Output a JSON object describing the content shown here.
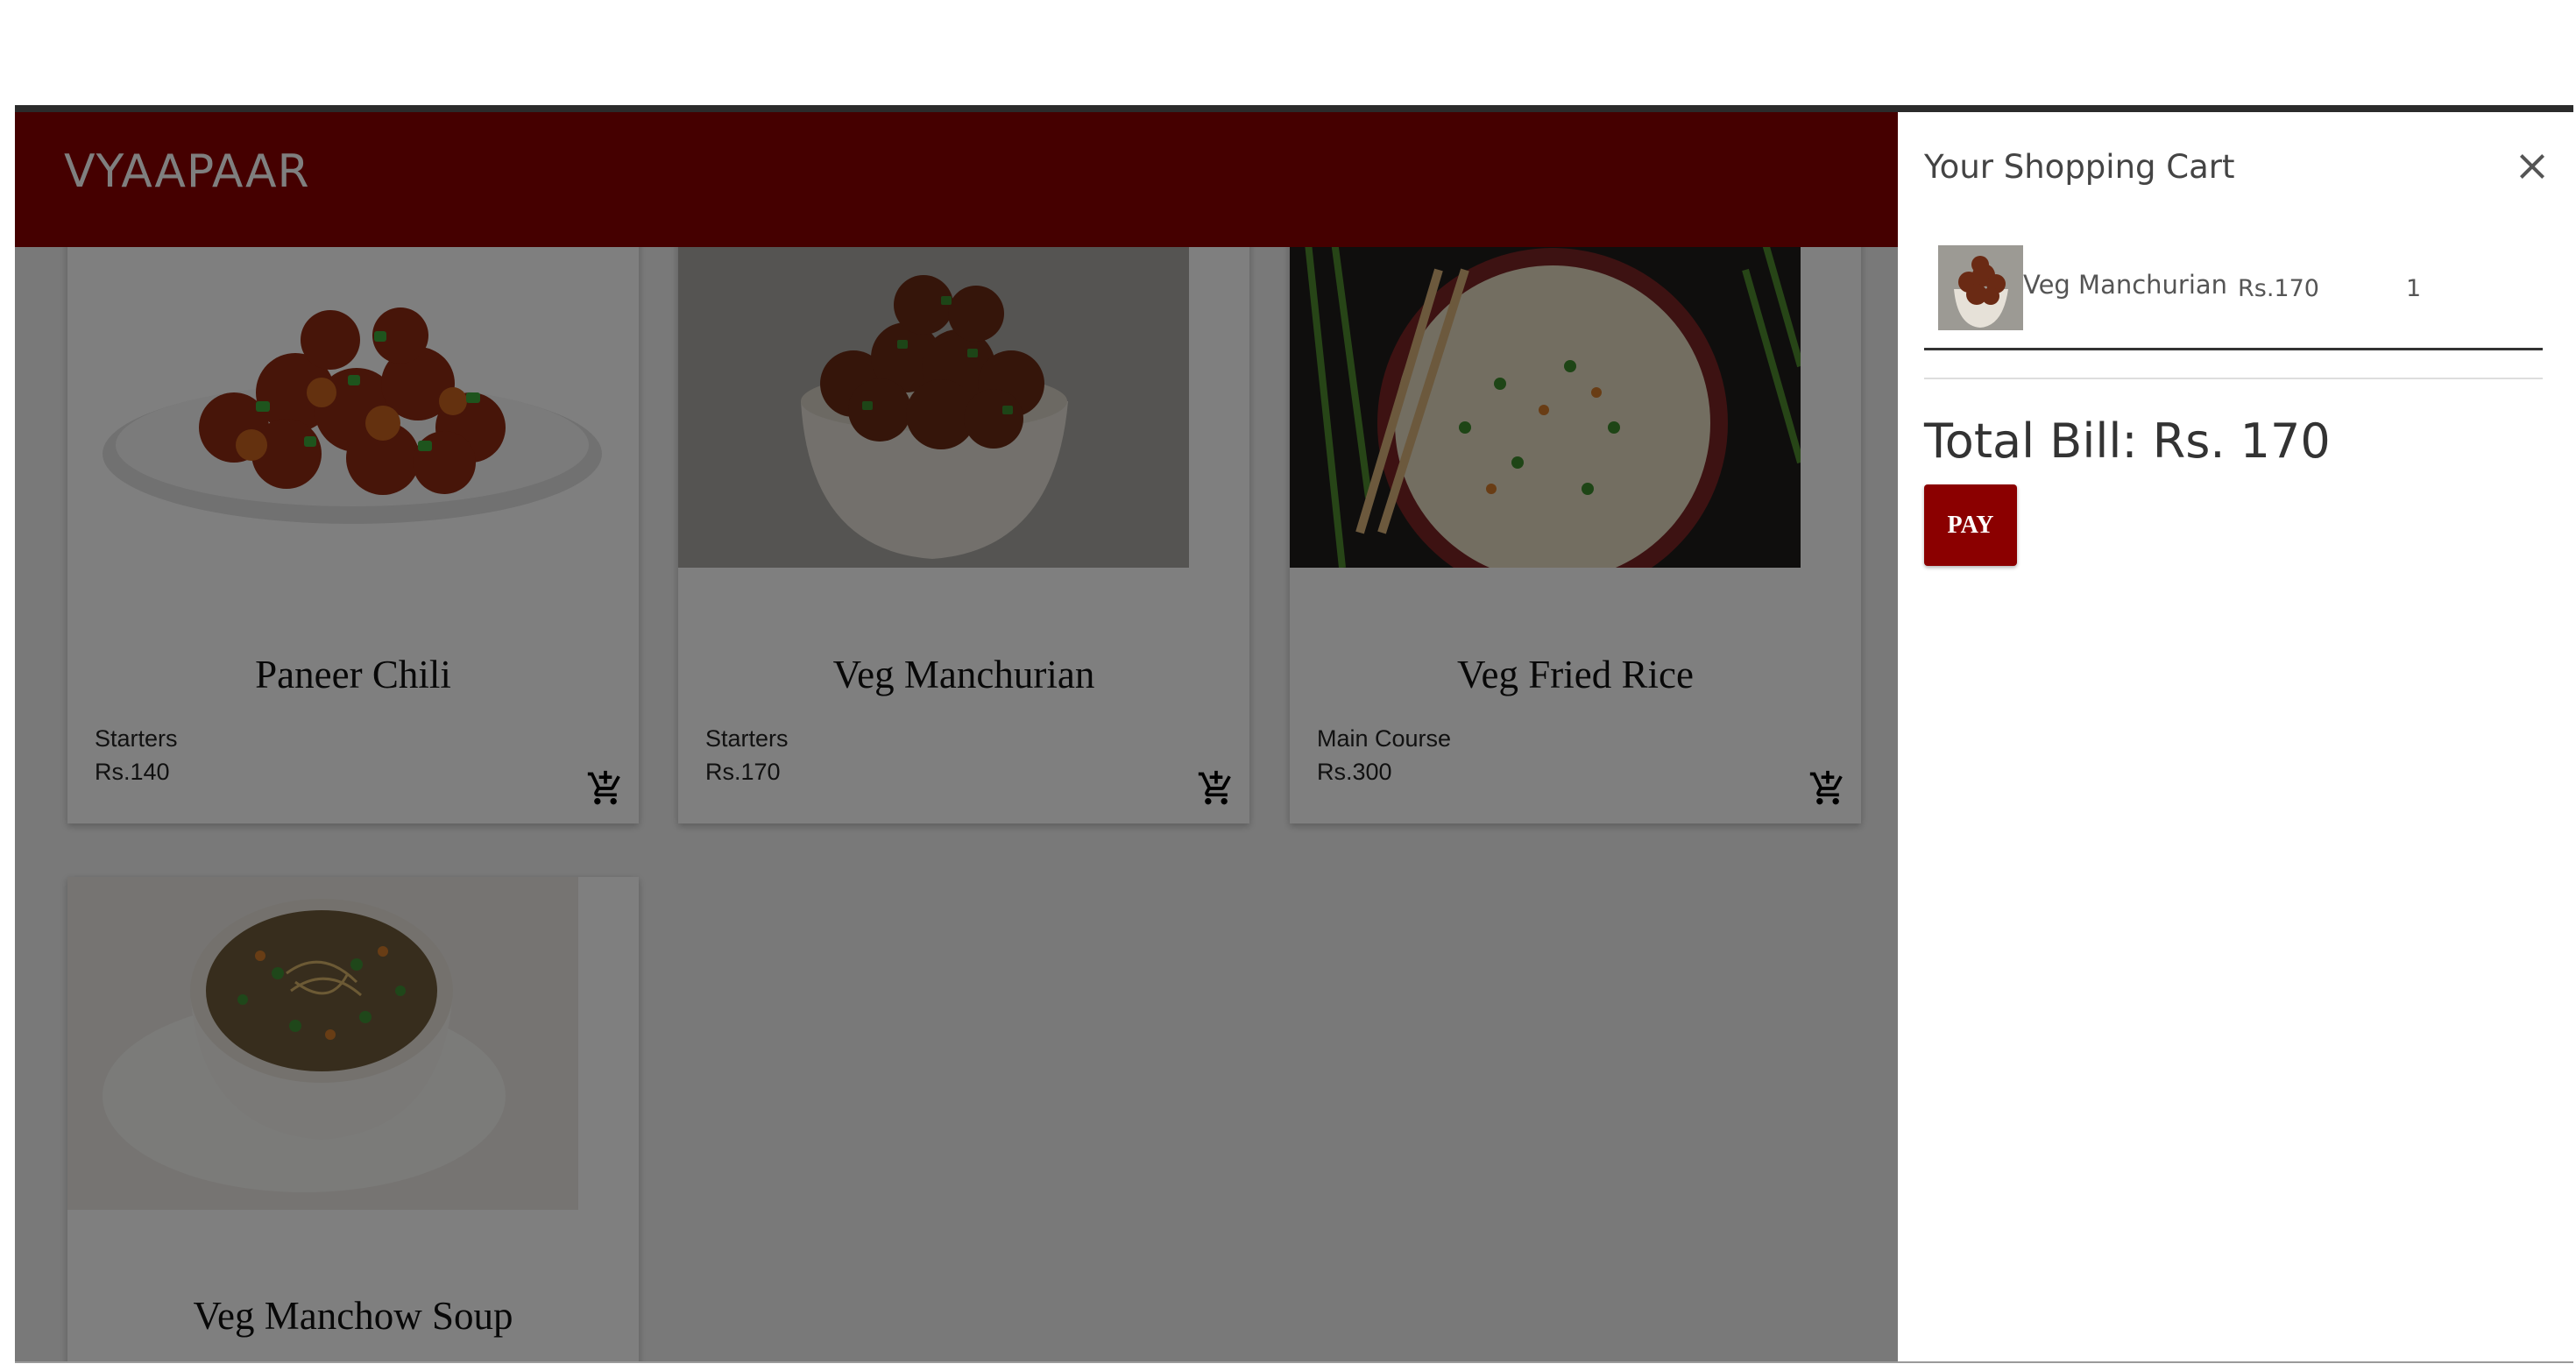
{
  "app": {
    "brand": "VYAAPAAR",
    "accent_color": "#8b0000"
  },
  "products": [
    {
      "name": "Paneer Chili",
      "category": "Starters",
      "price": "Rs.140",
      "image_icon": "paneer-chili-dish",
      "add_icon": "add-to-cart-icon"
    },
    {
      "name": "Veg Manchurian",
      "category": "Starters",
      "price": "Rs.170",
      "image_icon": "veg-manchurian-dish",
      "add_icon": "add-to-cart-icon"
    },
    {
      "name": "Veg Fried Rice",
      "category": "Main Course",
      "price": "Rs.300",
      "image_icon": "fried-rice-dish",
      "add_icon": "add-to-cart-icon"
    },
    {
      "name": "Veg Manchow Soup",
      "image_icon": "soup-dish"
    }
  ],
  "cart": {
    "title": "Your Shopping Cart",
    "close_icon": "close-icon",
    "items": [
      {
        "name": "Veg Manchurian",
        "price": "Rs.170",
        "quantity": "1",
        "thumb_icon": "veg-manchurian-thumbnail"
      }
    ],
    "total_label": "Total Bill: Rs. 170",
    "pay_label": "PAY"
  }
}
